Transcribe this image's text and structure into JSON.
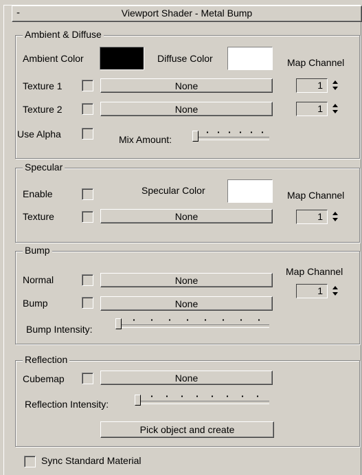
{
  "rollout": {
    "collapse_glyph": "-",
    "title": "Viewport Shader - Metal Bump"
  },
  "ambient_diffuse": {
    "label": "Ambient & Diffuse",
    "ambient_color_label": "Ambient Color",
    "ambient_color": "#000000",
    "diffuse_color_label": "Diffuse Color",
    "diffuse_color": "#ffffff",
    "map_channel_label": "Map Channel",
    "texture1_label": "Texture 1",
    "texture1_map": "None",
    "texture1_channel": "1",
    "texture2_label": "Texture 2",
    "texture2_map": "None",
    "texture2_channel": "1",
    "use_alpha_label": "Use Alpha",
    "mix_amount_label": "Mix Amount:"
  },
  "specular": {
    "label": "Specular",
    "enable_label": "Enable",
    "specular_color_label": "Specular Color",
    "specular_color": "#ffffff",
    "map_channel_label": "Map Channel",
    "texture_label": "Texture",
    "texture_map": "None",
    "texture_channel": "1"
  },
  "bump": {
    "label": "Bump",
    "map_channel_label": "Map Channel",
    "normal_label": "Normal",
    "normal_map": "None",
    "bump_label": "Bump",
    "bump_map": "None",
    "channel": "1",
    "intensity_label": "Bump Intensity:"
  },
  "reflection": {
    "label": "Reflection",
    "cubemap_label": "Cubemap",
    "cubemap_map": "None",
    "intensity_label": "Reflection Intensity:",
    "pick_button": "Pick object and create"
  },
  "footer": {
    "sync_label": "Sync Standard Material"
  }
}
